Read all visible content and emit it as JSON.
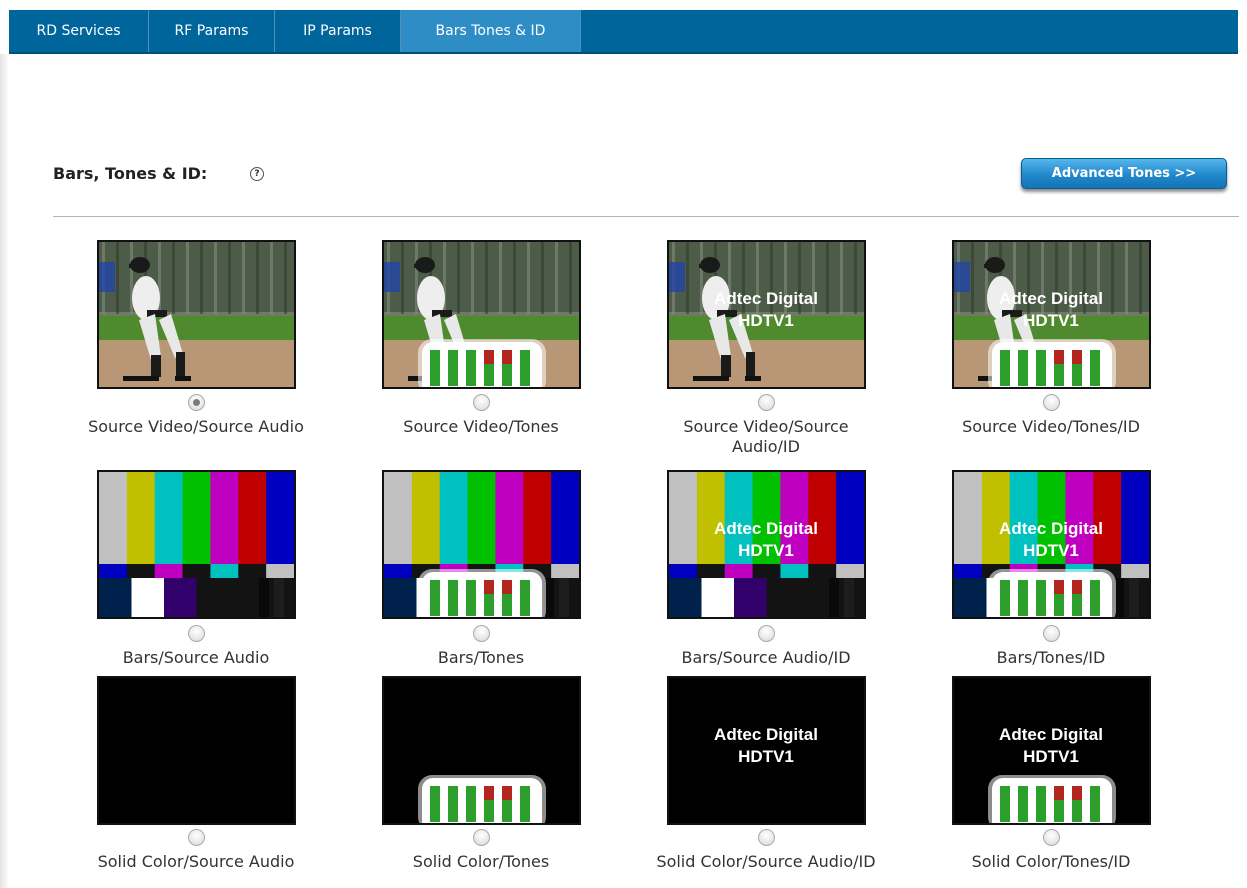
{
  "tabs": [
    {
      "label": "RD Services",
      "active": false
    },
    {
      "label": "RF Params",
      "active": false
    },
    {
      "label": "IP Params",
      "active": false
    },
    {
      "label": "Bars Tones & ID",
      "active": true
    }
  ],
  "section": {
    "title": "Bars, Tones & ID:",
    "help_icon": "help-circle-icon",
    "advanced_button": "Advanced Tones >>"
  },
  "overlay_text": {
    "line1": "Adtec Digital",
    "line2": "HDTV1"
  },
  "options": [
    {
      "label": "Source Video/Source Audio",
      "bg": "source",
      "tones": false,
      "id": false,
      "checked": true
    },
    {
      "label": "Source Video/Tones",
      "bg": "source",
      "tones": true,
      "id": false,
      "checked": false
    },
    {
      "label": "Source Video/Source Audio/ID",
      "bg": "source",
      "tones": false,
      "id": true,
      "checked": false
    },
    {
      "label": "Source Video/Tones/ID",
      "bg": "source",
      "tones": true,
      "id": true,
      "checked": false
    },
    {
      "label": "Bars/Source Audio",
      "bg": "bars",
      "tones": false,
      "id": false,
      "checked": false
    },
    {
      "label": "Bars/Tones",
      "bg": "bars",
      "tones": true,
      "id": false,
      "checked": false
    },
    {
      "label": "Bars/Source Audio/ID",
      "bg": "bars",
      "tones": false,
      "id": true,
      "checked": false
    },
    {
      "label": "Bars/Tones/ID",
      "bg": "bars",
      "tones": true,
      "id": true,
      "checked": false
    },
    {
      "label": "Solid Color/Source Audio",
      "bg": "solid",
      "tones": false,
      "id": false,
      "checked": false
    },
    {
      "label": "Solid Color/Tones",
      "bg": "solid",
      "tones": true,
      "id": false,
      "checked": false
    },
    {
      "label": "Solid Color/Source Audio/ID",
      "bg": "solid",
      "tones": false,
      "id": true,
      "checked": false
    },
    {
      "label": "Solid Color/Tones/ID",
      "bg": "solid",
      "tones": true,
      "id": true,
      "checked": false
    }
  ],
  "colors": {
    "tabbar": "#00659b",
    "tab_active": "#2f8dc6",
    "button": "#2188cc",
    "bars_top": [
      "#c0c0c0",
      "#c0c000",
      "#00c0c0",
      "#00c000",
      "#c000c0",
      "#c00000",
      "#0000c0"
    ],
    "meter_green": "#2c9e2c",
    "meter_red": "#b3261e"
  }
}
